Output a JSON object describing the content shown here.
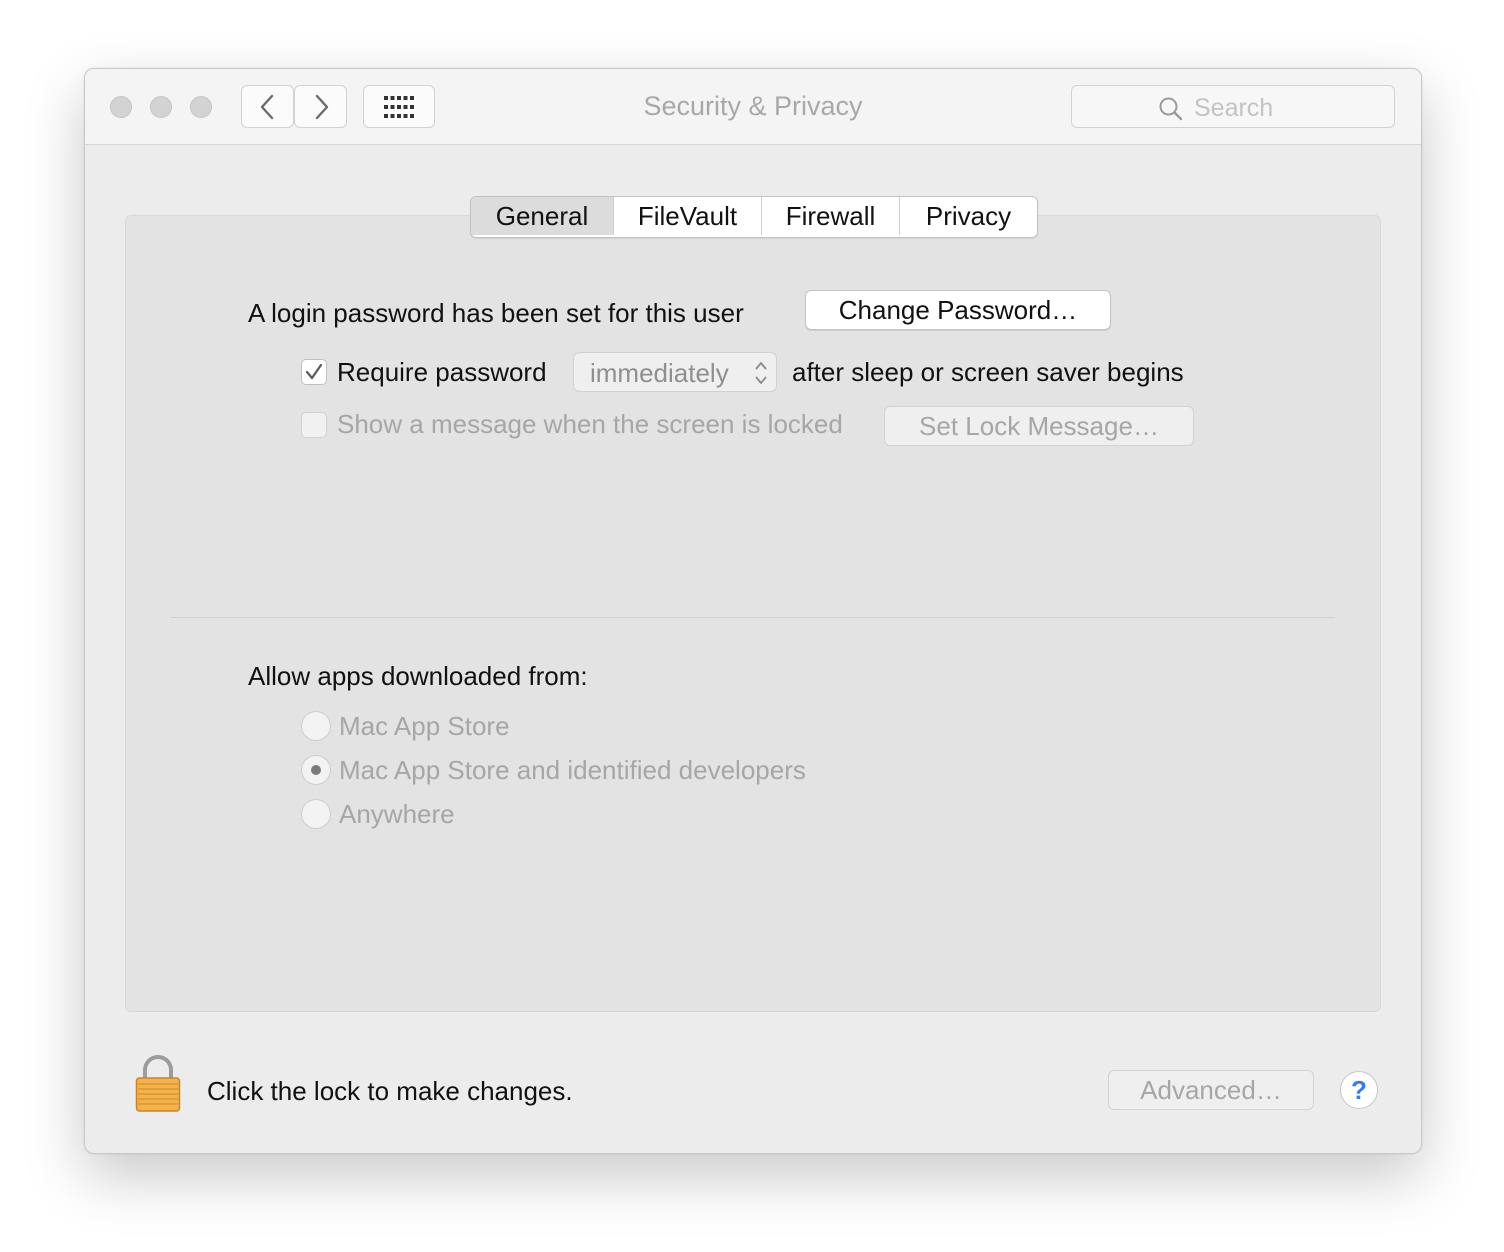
{
  "window": {
    "title": "Security & Privacy",
    "search_placeholder": "Search"
  },
  "tabs": [
    {
      "label": "General",
      "selected": true
    },
    {
      "label": "FileVault",
      "selected": false
    },
    {
      "label": "Firewall",
      "selected": false
    },
    {
      "label": "Privacy",
      "selected": false
    }
  ],
  "general": {
    "password_text": "A login password has been set for this user",
    "change_password_button": "Change Password…",
    "require_password": {
      "label": "Require password",
      "checked": true
    },
    "require_password_delay": "immediately",
    "after_sleep_text": "after sleep or screen saver begins",
    "show_message": {
      "label": "Show a message when the screen is locked",
      "checked": false
    },
    "set_lock_message_button": "Set Lock Message…"
  },
  "allow_apps": {
    "heading": "Allow apps downloaded from:",
    "options": [
      {
        "label": "Mac App Store",
        "selected": false
      },
      {
        "label": "Mac App Store and identified developers",
        "selected": true
      },
      {
        "label": "Anywhere",
        "selected": false
      }
    ]
  },
  "footer": {
    "lock_text": "Click the lock to make changes.",
    "advanced_button": "Advanced…",
    "help_label": "?"
  },
  "icons": {
    "back": "chevron-left-icon",
    "forward": "chevron-right-icon",
    "grid": "grid-icon",
    "search": "search-icon",
    "lock": "lock-icon",
    "check": "checkmark-icon"
  },
  "colors": {
    "window_bg": "#ececec",
    "panel_bg": "#e3e3e3",
    "help_accent": "#2f7ef0",
    "lock_gold": "#f0a63b"
  }
}
